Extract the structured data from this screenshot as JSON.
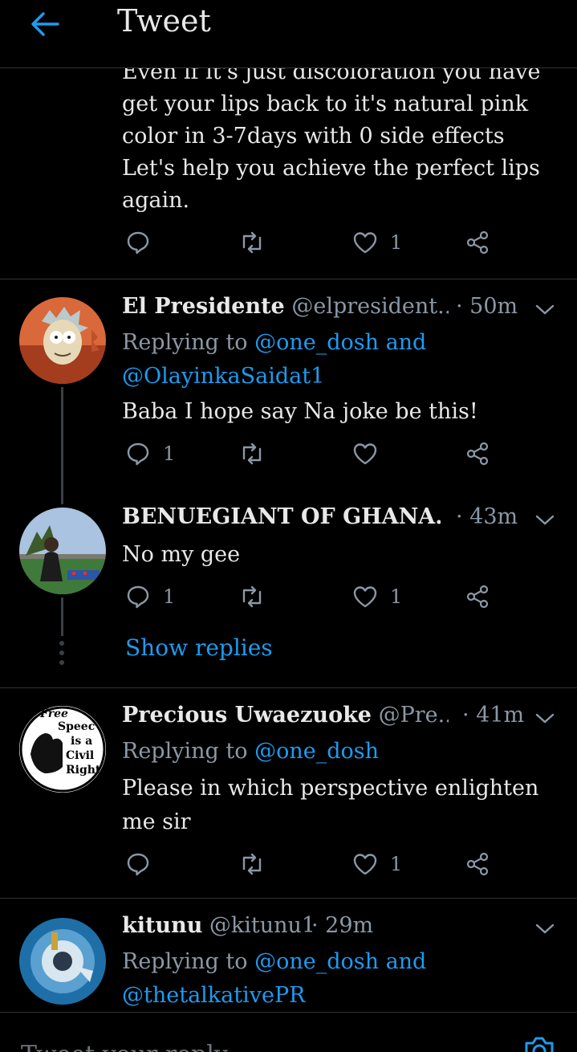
{
  "header": {
    "title": "Tweet"
  },
  "top_tweet": {
    "text": "Even if it's just discoloration you have get your lips back to it's natural pink color in 3-7days with 0 side effects Let's help you achieve the perfect lips again.",
    "reply_count": "",
    "retweet_count": "",
    "like_count": "1"
  },
  "replies": [
    {
      "name": "El Presidente",
      "handle": "@elpresident...",
      "time": "· 50m",
      "replying_prefix": "Replying to",
      "mentions": "@one_dosh and @OlayinkaSaidat1",
      "text": "Baba I hope say Na joke be this!",
      "reply_count": "1",
      "retweet_count": "",
      "like_count": ""
    },
    {
      "name": "BENUEGIANT OF GHANA...",
      "handle": "",
      "time": "· 43m",
      "text": "No my gee",
      "reply_count": "1",
      "retweet_count": "",
      "like_count": "1",
      "show_replies": "Show replies"
    },
    {
      "name": "Precious Uwaezuoke",
      "handle": "@Pre...",
      "time": "· 41m",
      "replying_prefix": "Replying to",
      "mentions": "@one_dosh",
      "text": "Please in which perspective enlighten me sir",
      "reply_count": "",
      "retweet_count": "",
      "like_count": "1",
      "avatar_text": [
        "Free",
        "Speec",
        "is a",
        "Civil",
        "Right"
      ]
    },
    {
      "name": "kitunu",
      "handle": "@kitunu1",
      "time": "· 29m",
      "replying_prefix": "Replying to",
      "mentions": "@one_dosh and @thetalkativePR"
    }
  ],
  "composer": {
    "placeholder": "Tweet your reply"
  },
  "colors": {
    "accent": "#1d9bf0",
    "muted": "#8b98a5",
    "background": "#000000"
  },
  "icons": [
    "back-arrow-icon",
    "reply-icon",
    "retweet-icon",
    "like-icon",
    "share-icon",
    "chevron-down-icon",
    "camera-icon"
  ]
}
